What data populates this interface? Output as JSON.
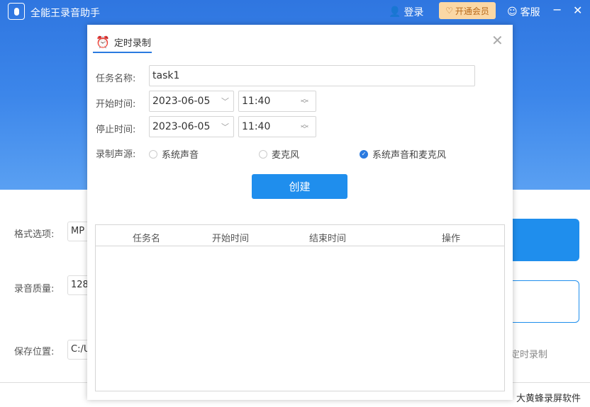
{
  "app": {
    "title": "全能王录音助手",
    "login": "登录",
    "vip": "开通会员",
    "service": "客服",
    "minimize": "−",
    "close": "✕"
  },
  "main": {
    "format_label": "格式选项:",
    "format_value": "MP",
    "quality_label": "录音质量:",
    "quality_value": "128",
    "save_label": "保存位置:",
    "save_value": "C:/U",
    "schedule_link": "定时录制",
    "brand": "大黄蜂录屏软件"
  },
  "dialog": {
    "tab": "定时录制",
    "close": "✕",
    "task_name_label": "任务名称:",
    "task_name_value": "task1",
    "start_label": "开始时间:",
    "start_date": "2023-06-05",
    "start_time": "11:40",
    "stop_label": "停止时间:",
    "stop_date": "2023-06-05",
    "stop_time": "11:40",
    "source_label": "录制声源:",
    "sources": [
      {
        "label": "系统声音",
        "checked": false
      },
      {
        "label": "麦克风",
        "checked": false
      },
      {
        "label": "系统声音和麦克风",
        "checked": true
      }
    ],
    "create": "创建",
    "columns": [
      "任务名",
      "开始时间",
      "结束时间",
      "操作"
    ],
    "rows": []
  }
}
